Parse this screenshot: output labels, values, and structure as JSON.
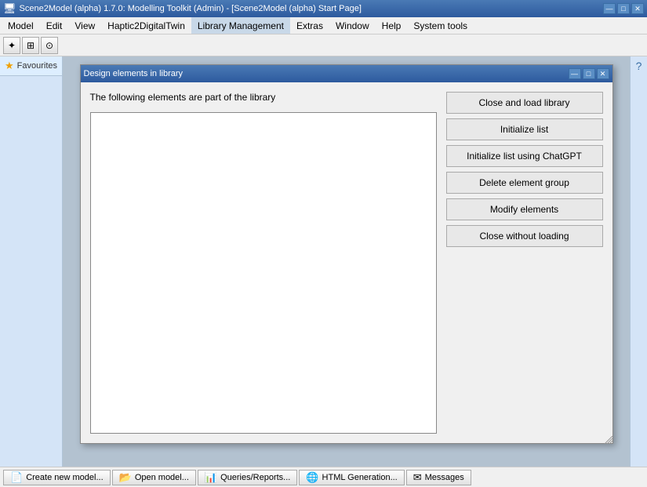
{
  "titlebar": {
    "title": "Scene2Model (alpha) 1.7.0: Modelling Toolkit (Admin) - [Scene2Model (alpha) Start Page]",
    "minimize": "—",
    "maximize": "□",
    "close": "✕"
  },
  "menubar": {
    "items": [
      {
        "label": "Model"
      },
      {
        "label": "Edit"
      },
      {
        "label": "View"
      },
      {
        "label": "Haptic2DigitalTwin"
      },
      {
        "label": "Library Management"
      },
      {
        "label": "Extras"
      },
      {
        "label": "Window"
      },
      {
        "label": "Help"
      },
      {
        "label": "System tools"
      }
    ]
  },
  "toolbar": {
    "buttons": [
      "⊞",
      "⊡",
      "⊟"
    ]
  },
  "sidebar": {
    "favourites_label": "Favourites"
  },
  "dialog": {
    "title": "Design elements in library",
    "minimize": "—",
    "maximize": "□",
    "close": "✕",
    "description_label": "The following elements are part of the library",
    "buttons": [
      {
        "label": "Close and load library",
        "key": "close-load-btn"
      },
      {
        "label": "Initialize list",
        "key": "init-list-btn"
      },
      {
        "label": "Initialize list using ChatGPT",
        "key": "init-chatgpt-btn"
      },
      {
        "label": "Delete element group",
        "key": "delete-group-btn"
      },
      {
        "label": "Modify elements",
        "key": "modify-elements-btn"
      },
      {
        "label": "Close without loading",
        "key": "close-no-load-btn"
      }
    ]
  },
  "taskbar": {
    "items": [
      {
        "icon": "📄",
        "label": "Create new model..."
      },
      {
        "icon": "📂",
        "label": "Open model..."
      },
      {
        "icon": "📊",
        "label": "Queries/Reports..."
      },
      {
        "icon": "🌐",
        "label": "HTML Generation..."
      },
      {
        "icon": "✉",
        "label": "Messages"
      }
    ]
  }
}
